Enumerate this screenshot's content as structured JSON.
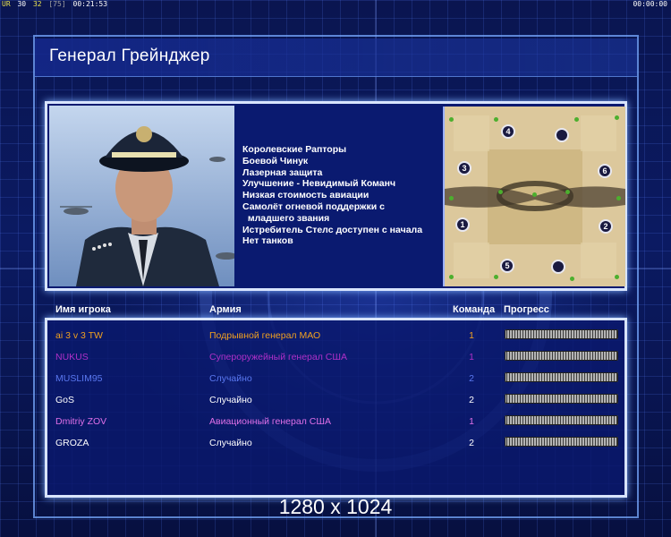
{
  "hud": {
    "left_items": [
      "UR",
      "30",
      "32",
      "[75]",
      "00:21:53"
    ],
    "right_time": "00:00:00"
  },
  "title": "Генерал Грейнджер",
  "traits": [
    "Королевские Рапторы",
    "Боевой Чинук",
    "Лазерная защита",
    "Улучшение - Невидимый Команч",
    "Низкая стоимость авиации",
    "Самолёт огневой поддержки с",
    "  младшего звания",
    "Истребитель Стелс доступен с начала",
    "Нет танков"
  ],
  "map": {
    "spawn_labels": [
      "4",
      "",
      "3",
      "6",
      "1",
      "2",
      "5",
      ""
    ]
  },
  "table": {
    "headers": {
      "name": "Имя игрока",
      "army": "Армия",
      "team": "Команда",
      "progress": "Прогресс"
    },
    "rows": [
      {
        "name": "ai 3 v 3 TW",
        "army": "Подрывной генерал МАО",
        "team": "1",
        "color": "#f0a020",
        "progress": 1.0
      },
      {
        "name": "NUKUS",
        "army": "Супероружейный генерал США",
        "team": "1",
        "color": "#b030c8",
        "progress": 1.0
      },
      {
        "name": "MUSLIM95",
        "army": "Случайно",
        "team": "2",
        "color": "#5a78f0",
        "progress": 1.0
      },
      {
        "name": "GoS",
        "army": "Случайно",
        "team": "2",
        "color": "#ffffff",
        "progress": 1.0
      },
      {
        "name": "Dmitriy ZOV",
        "army": "Авиационный генерал США",
        "team": "1",
        "color": "#e070e8",
        "progress": 1.0
      },
      {
        "name": "GROZA",
        "army": "Случайно",
        "team": "2",
        "color": "#ffffff",
        "progress": 1.0
      }
    ]
  },
  "resolution": "1280 x 1024"
}
